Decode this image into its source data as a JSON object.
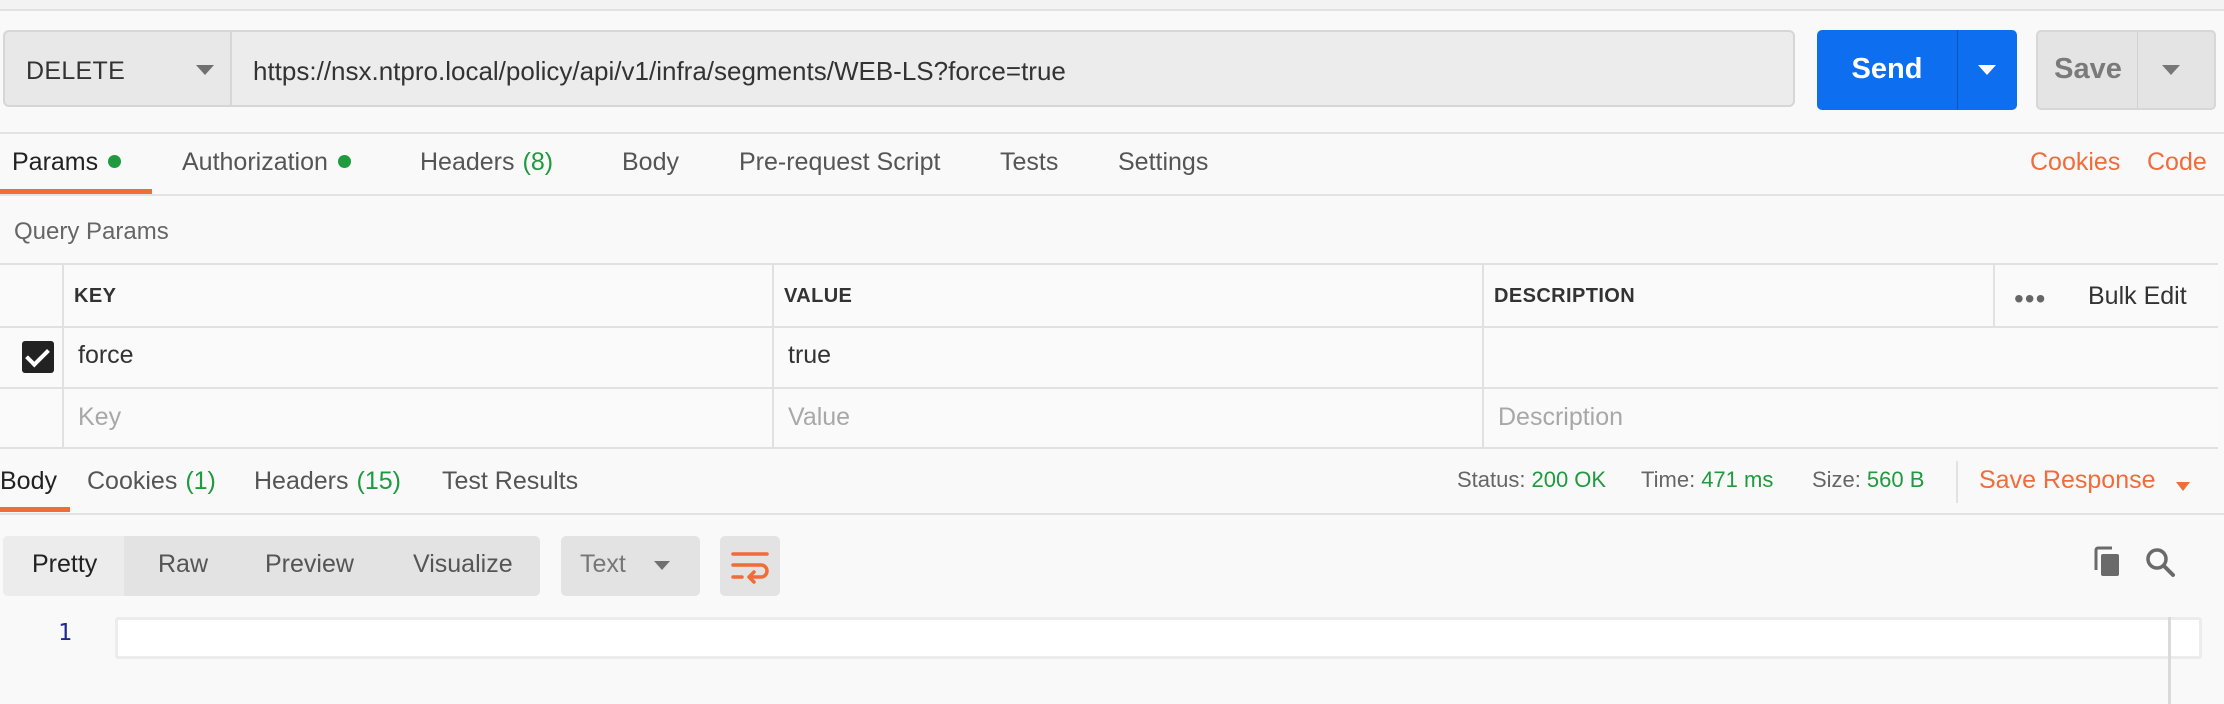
{
  "request": {
    "method": "DELETE",
    "url": "https://nsx.ntpro.local/policy/api/v1/infra/segments/WEB-LS?force=true",
    "send_label": "Send",
    "save_label": "Save"
  },
  "request_tabs": {
    "params": "Params",
    "authorization": "Authorization",
    "headers": "Headers",
    "headers_count": "(8)",
    "body": "Body",
    "pre_request": "Pre-request Script",
    "tests": "Tests",
    "settings": "Settings",
    "cookies": "Cookies",
    "code": "Code"
  },
  "query_params": {
    "title": "Query Params",
    "headers": {
      "key": "KEY",
      "value": "VALUE",
      "description": "DESCRIPTION"
    },
    "bulk_edit": "Bulk Edit",
    "rows": [
      {
        "checked": true,
        "key": "force",
        "value": "true",
        "description": ""
      }
    ],
    "placeholders": {
      "key": "Key",
      "value": "Value",
      "description": "Description"
    }
  },
  "response_tabs": {
    "body": "Body",
    "cookies": "Cookies",
    "cookies_count": "(1)",
    "headers": "Headers",
    "headers_count": "(15)",
    "test_results": "Test Results"
  },
  "response_status": {
    "status_label": "Status:",
    "status_value": "200 OK",
    "time_label": "Time:",
    "time_value": "471 ms",
    "size_label": "Size:",
    "size_value": "560 B",
    "save_response": "Save Response"
  },
  "response_view": {
    "modes": [
      "Pretty",
      "Raw",
      "Preview",
      "Visualize"
    ],
    "format": "Text",
    "line_numbers": [
      "1"
    ]
  },
  "colors": {
    "accent": "#f26b3a",
    "send": "#0d6ff0",
    "success": "#1f9a3f"
  }
}
